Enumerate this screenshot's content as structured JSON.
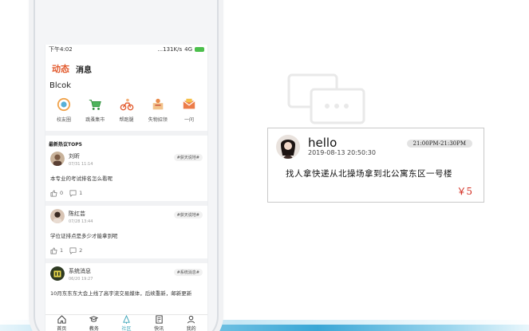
{
  "status_bar": {
    "time": "下午4:02",
    "network": "...131K/s",
    "signal": "4G"
  },
  "top_tabs": [
    {
      "label": "动态",
      "active": true
    },
    {
      "label": "消息",
      "active": false
    }
  ],
  "username": "Blcok",
  "shortcuts": [
    {
      "label": "校友圈",
      "icon": "circle-icon"
    },
    {
      "label": "跳蚤集市",
      "icon": "cart-icon"
    },
    {
      "label": "帮跑腿",
      "icon": "bike-icon"
    },
    {
      "label": "失物招领",
      "icon": "lost-found-icon"
    },
    {
      "label": "一问",
      "icon": "envelope-icon"
    }
  ],
  "section_title": "最新热议TOP5",
  "posts": [
    {
      "name": "刘昕",
      "date": "07/31 11:14",
      "tag": "#获天说地#",
      "content": "本专业的考试排名怎么看呢",
      "likes": "0",
      "comments": "1"
    },
    {
      "name": "陈红芸",
      "date": "07/28 13:44",
      "tag": "#获天说地#",
      "content": "学位证排点是多少才能拿到呢",
      "likes": "1",
      "comments": "2"
    },
    {
      "name": "系统消息",
      "date": "06/20 19:27",
      "tag": "#系统消息#",
      "content": "10月东东东大会上线了高宇流交易媒体，后续重新，邮新更新",
      "likes": "",
      "comments": ""
    }
  ],
  "tabbar": [
    {
      "label": "首页",
      "icon": "home-icon",
      "active": false
    },
    {
      "label": "教务",
      "icon": "hat-icon",
      "active": false
    },
    {
      "label": "社区",
      "icon": "tree-icon",
      "active": true
    },
    {
      "label": "快讯",
      "icon": "news-icon",
      "active": false
    },
    {
      "label": "我的",
      "icon": "user-icon",
      "active": false
    }
  ],
  "message_card": {
    "title": "hello",
    "time": "2019-08-13 20:50:30",
    "range": "21:00PM-21:30PM",
    "body": "找人拿快递从北操场拿到北公寓东区一号楼",
    "price": "￥5"
  },
  "colors": {
    "accent": "#e2592c",
    "price": "#d22a1e",
    "active_tab": "#3aa4b8"
  }
}
